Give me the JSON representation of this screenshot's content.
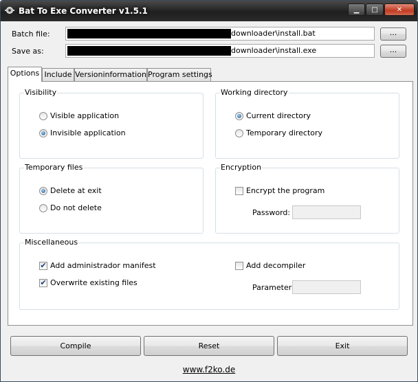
{
  "window": {
    "title": "Bat To Exe Converter v1.5.1",
    "minimize_glyph": "▁",
    "maximize_glyph": "□",
    "close_glyph": "✕"
  },
  "batch_file": {
    "label": "Batch file:",
    "value": "downloader\\install.bat",
    "browse_label": "..."
  },
  "save_as": {
    "label": "Save as:",
    "value": "downloader\\install.exe",
    "browse_label": "..."
  },
  "tabs": [
    {
      "label": "Options",
      "active": true
    },
    {
      "label": "Include",
      "active": false
    },
    {
      "label": "Versioninformations",
      "active": false
    },
    {
      "label": "Program settings",
      "active": false
    }
  ],
  "visibility": {
    "title": "Visibility",
    "visible_label": "Visible application",
    "visible_checked": false,
    "invisible_label": "Invisible application",
    "invisible_checked": true
  },
  "working_directory": {
    "title": "Working directory",
    "current_label": "Current directory",
    "current_checked": true,
    "temporary_label": "Temporary directory",
    "temporary_checked": false
  },
  "temporary_files": {
    "title": "Temporary files",
    "delete_label": "Delete at exit",
    "delete_checked": true,
    "keep_label": "Do not delete",
    "keep_checked": false
  },
  "encryption": {
    "title": "Encryption",
    "encrypt_label": "Encrypt the program",
    "encrypt_checked": false,
    "password_label": "Password:",
    "password_value": ""
  },
  "miscellaneous": {
    "title": "Miscellaneous",
    "admin_manifest_label": "Add administrador manifest",
    "admin_manifest_checked": true,
    "overwrite_label": "Overwrite existing files",
    "overwrite_checked": true,
    "decompiler_label": "Add decompiler",
    "decompiler_checked": false,
    "parameter_label": "Parameter:",
    "parameter_value": ""
  },
  "buttons": {
    "compile": "Compile",
    "reset": "Reset",
    "exit": "Exit"
  },
  "footer": {
    "link": "www.f2ko.de"
  },
  "check_glyph": "✔"
}
